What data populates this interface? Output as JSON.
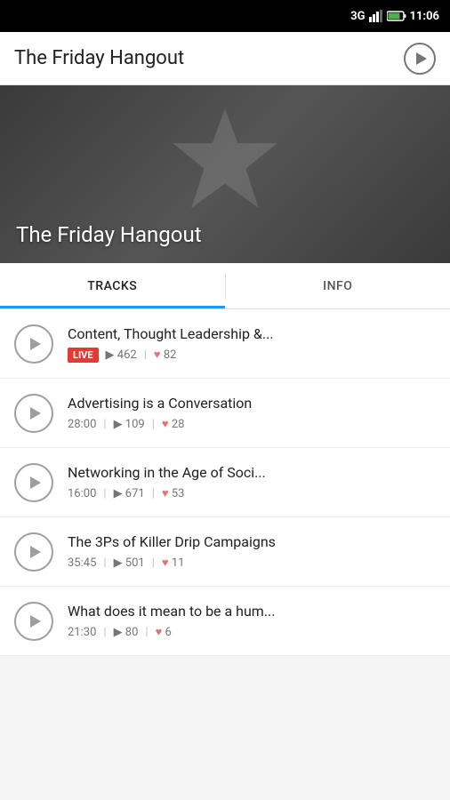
{
  "statusBar": {
    "network": "3G",
    "time": "11:06"
  },
  "header": {
    "title": "The Friday Hangout",
    "playButtonLabel": "Play"
  },
  "hero": {
    "title": "The Friday Hangout"
  },
  "tabs": [
    {
      "id": "tracks",
      "label": "TRACKS",
      "active": true
    },
    {
      "id": "info",
      "label": "INFO",
      "active": false
    }
  ],
  "tracks": [
    {
      "title": "Content, Thought Leadership &...",
      "isLive": true,
      "duration": null,
      "plays": "462",
      "likes": "82"
    },
    {
      "title": "Advertising is a Conversation",
      "isLive": false,
      "duration": "28:00",
      "plays": "109",
      "likes": "28"
    },
    {
      "title": "Networking in the Age of Soci...",
      "isLive": false,
      "duration": "16:00",
      "plays": "671",
      "likes": "53"
    },
    {
      "title": "The 3Ps of Killer Drip Campaigns",
      "isLive": false,
      "duration": "35:45",
      "plays": "501",
      "likes": "11"
    },
    {
      "title": "What does it mean to be a hum...",
      "isLive": false,
      "duration": "21:30",
      "plays": "80",
      "likes": "6"
    }
  ],
  "labels": {
    "live": "LIVE",
    "plays_prefix": "▶",
    "likes_prefix": "♥",
    "separator": "|"
  }
}
